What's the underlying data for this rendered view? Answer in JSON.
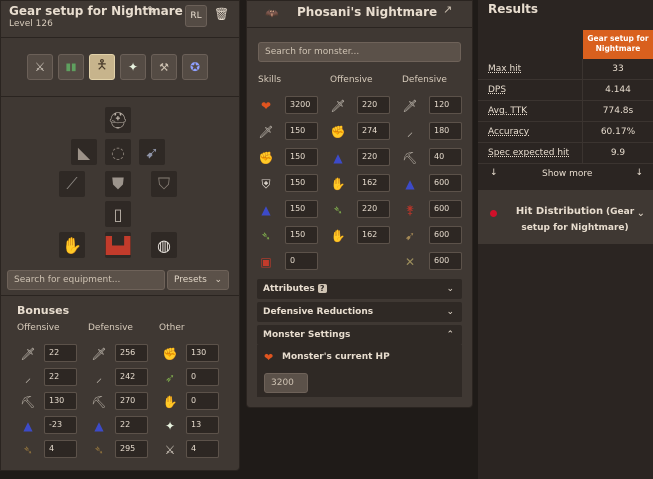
{
  "left": {
    "title": "Gear setup for Nightmare",
    "level": "Level 126",
    "equip_search_placeholder": "Search for equipment...",
    "presets_label": "Presets",
    "bonuses_title": "Bonuses",
    "headers": {
      "offensive": "Offensive",
      "defensive": "Defensive",
      "other": "Other"
    },
    "offensive": [
      "22",
      "22",
      "130",
      "-23",
      "4"
    ],
    "defensive": [
      "256",
      "242",
      "270",
      "22",
      "295"
    ],
    "other": [
      "130",
      "0",
      "0",
      "13",
      "4"
    ]
  },
  "mid": {
    "title": "Phosani's Nightmare",
    "search_placeholder": "Search for monster...",
    "headers": {
      "skills": "Skills",
      "offensive": "Offensive",
      "defensive": "Defensive"
    },
    "skills": [
      "3200",
      "150",
      "150",
      "150",
      "150",
      "150",
      "0"
    ],
    "offensive": [
      "220",
      "274",
      "220",
      "162",
      "220",
      "162"
    ],
    "defensive": [
      "120",
      "180",
      "40",
      "600",
      "600",
      "600",
      "600"
    ],
    "attributes_label": "Attributes",
    "attributes_help": "?",
    "def_reductions_label": "Defensive Reductions",
    "monster_settings_label": "Monster Settings",
    "current_hp_label": "Monster's current HP",
    "current_hp_value": "3200"
  },
  "right": {
    "title": "Results",
    "column_header": "Gear setup for Nightmare",
    "rows": [
      {
        "label": "Max hit",
        "value": "33"
      },
      {
        "label": "DPS",
        "value": "4.144"
      },
      {
        "label": "Avg. TTK",
        "value": "774.8s"
      },
      {
        "label": "Accuracy",
        "value": "60.17%"
      },
      {
        "label": "Spec expected hit",
        "value": "9.9"
      }
    ],
    "show_more": "Show more",
    "hit_dist_label": "Hit Distribution",
    "hit_dist_sub": "(Gear setup for Nightmare)"
  },
  "colors": {
    "accent": "#d9601e",
    "panel": "#3f3833",
    "background": "#1f1b18"
  }
}
